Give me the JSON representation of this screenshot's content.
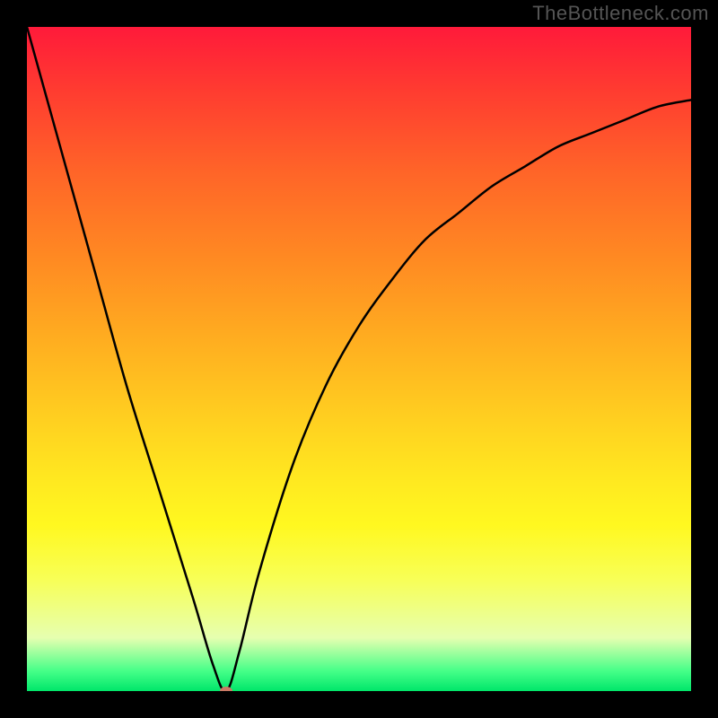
{
  "watermark": "TheBottleneck.com",
  "chart_data": {
    "type": "line",
    "title": "",
    "xlabel": "",
    "ylabel": "",
    "xlim": [
      0,
      100
    ],
    "ylim": [
      0,
      100
    ],
    "grid": false,
    "legend": false,
    "series": [
      {
        "name": "bottleneck-curve",
        "x": [
          0,
          5,
          10,
          15,
          20,
          25,
          28,
          30,
          32,
          35,
          40,
          45,
          50,
          55,
          60,
          65,
          70,
          75,
          80,
          85,
          90,
          95,
          100
        ],
        "values": [
          100,
          82,
          64,
          46,
          30,
          14,
          4,
          0,
          6,
          18,
          34,
          46,
          55,
          62,
          68,
          72,
          76,
          79,
          82,
          84,
          86,
          88,
          89
        ]
      }
    ],
    "marker": {
      "x": 30,
      "y": 0,
      "color": "#cc7a66"
    },
    "background_gradient": {
      "top": "#ff1a3a",
      "mid": "#ffe820",
      "bottom": "#00e66a"
    }
  }
}
